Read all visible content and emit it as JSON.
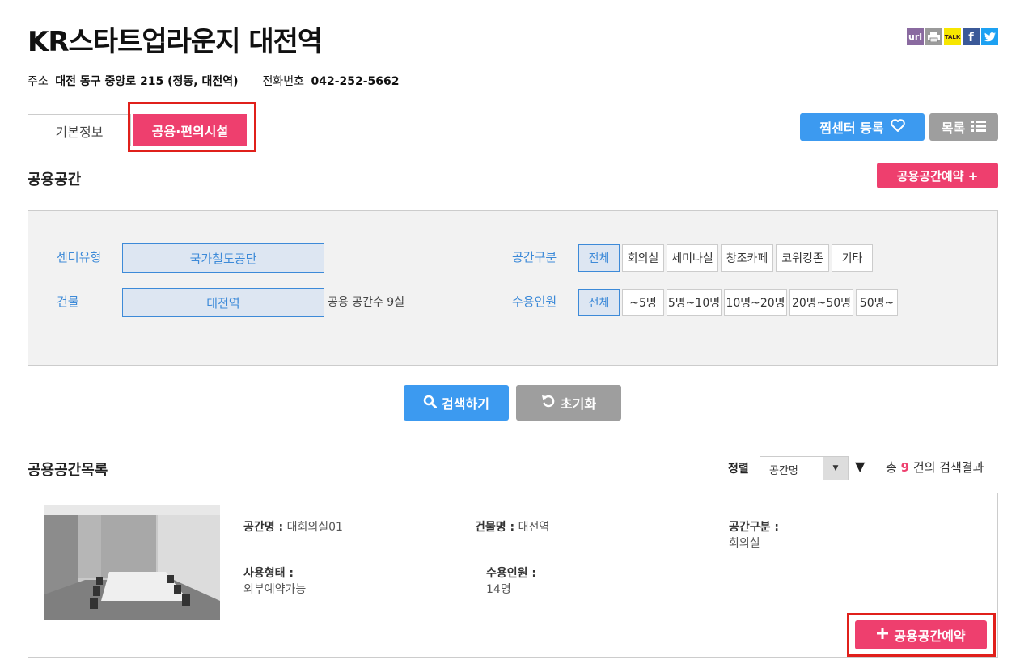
{
  "header": {
    "title": "KR스타트업라운지 대전역",
    "address_label": "주소",
    "address": "대전 동구 중앙로 215 (정동, 대전역)",
    "phone_label": "전화번호",
    "phone": "042-252-5662",
    "share": {
      "url": "url",
      "talk": "TALK",
      "facebook": "f",
      "twitter": "t"
    }
  },
  "tabs": [
    {
      "label": "기본정보",
      "active": false
    },
    {
      "label": "공용·편의시설",
      "active": true
    }
  ],
  "actions": {
    "favorite": "찜센터 등록",
    "list": "목록"
  },
  "section1": {
    "title": "공용공간",
    "reserve_btn": "공용공간예약 +"
  },
  "filter": {
    "center_type_label": "센터유형",
    "center_type_value": "국가철도공단",
    "building_label": "건물",
    "building_value": "대전역",
    "space_count": "공용 공간수  9실",
    "space_type_label": "공간구분",
    "space_types": [
      "전체",
      "회의실",
      "세미나실",
      "창조카페",
      "코워킹존",
      "기타"
    ],
    "capacity_label": "수용인원",
    "capacities": [
      "전체",
      "~5명",
      "5명~10명",
      "10명~20명",
      "20명~50명",
      "50명~"
    ]
  },
  "buttons": {
    "search": "검색하기",
    "reset": "초기화"
  },
  "section2": {
    "title": "공용공간목록",
    "sort_label": "정렬",
    "sort_value": "공간명",
    "result_prefix": "총",
    "result_count": "9",
    "result_suffix": "건의 검색결과"
  },
  "card": {
    "name_label": "공간명 :",
    "name": "대회의실01",
    "building_label": "건물명 :",
    "building": "대전역",
    "type_label": "공간구분 :",
    "type": "회의실",
    "usage_label": "사용형태 :",
    "usage": "외부예약가능",
    "capacity_label": "수용인원 :",
    "capacity": "14명",
    "reserve_btn": "공용공간예약"
  }
}
